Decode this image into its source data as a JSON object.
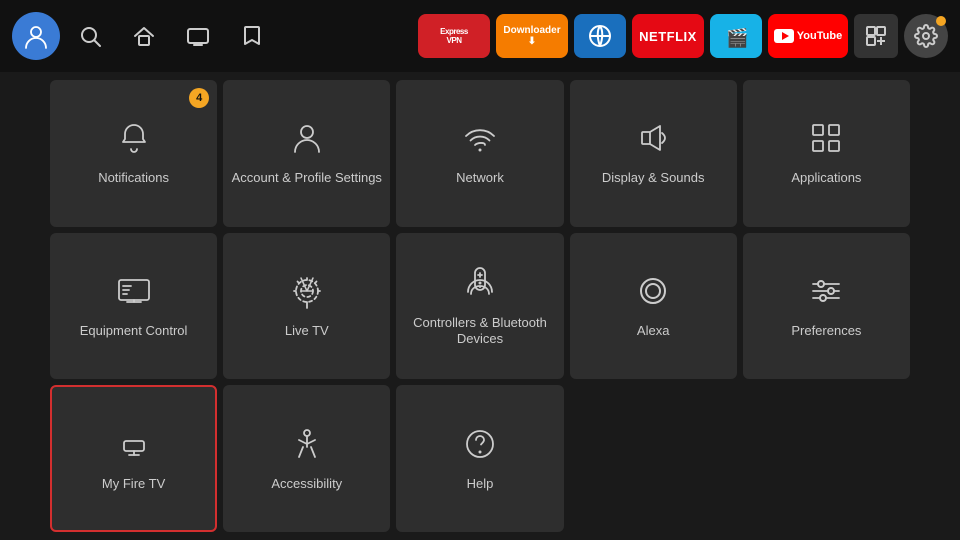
{
  "topbar": {
    "avatar_initial": "👤",
    "nav_icons": [
      "🔍",
      "🏠",
      "📺",
      "🔖"
    ],
    "apps": [
      {
        "name": "ExpressVPN",
        "label": "ExpressVPN"
      },
      {
        "name": "Downloader",
        "label": "Downloader ↓"
      },
      {
        "name": "Browser",
        "label": "↗"
      },
      {
        "name": "Netflix",
        "label": "NETFLIX"
      },
      {
        "name": "Kodi",
        "label": "🎬"
      },
      {
        "name": "YouTube",
        "label": "▶ YouTube"
      }
    ],
    "settings_dot_visible": true
  },
  "grid": {
    "cells": [
      {
        "id": "notifications",
        "label": "Notifications",
        "badge": "4",
        "icon": "bell"
      },
      {
        "id": "account-profile",
        "label": "Account & Profile Settings",
        "badge": null,
        "icon": "person"
      },
      {
        "id": "network",
        "label": "Network",
        "badge": null,
        "icon": "wifi"
      },
      {
        "id": "display-sounds",
        "label": "Display & Sounds",
        "badge": null,
        "icon": "speaker"
      },
      {
        "id": "applications",
        "label": "Applications",
        "badge": null,
        "icon": "apps"
      },
      {
        "id": "equipment-control",
        "label": "Equipment Control",
        "badge": null,
        "icon": "tv"
      },
      {
        "id": "live-tv",
        "label": "Live TV",
        "badge": null,
        "icon": "antenna"
      },
      {
        "id": "controllers-bluetooth",
        "label": "Controllers & Bluetooth Devices",
        "badge": null,
        "icon": "remote"
      },
      {
        "id": "alexa",
        "label": "Alexa",
        "badge": null,
        "icon": "alexa"
      },
      {
        "id": "preferences",
        "label": "Preferences",
        "badge": null,
        "icon": "sliders"
      },
      {
        "id": "my-fire-tv",
        "label": "My Fire TV",
        "badge": null,
        "icon": "firetv",
        "selected": true
      },
      {
        "id": "accessibility",
        "label": "Accessibility",
        "badge": null,
        "icon": "accessibility"
      },
      {
        "id": "help",
        "label": "Help",
        "badge": null,
        "icon": "help"
      }
    ]
  }
}
